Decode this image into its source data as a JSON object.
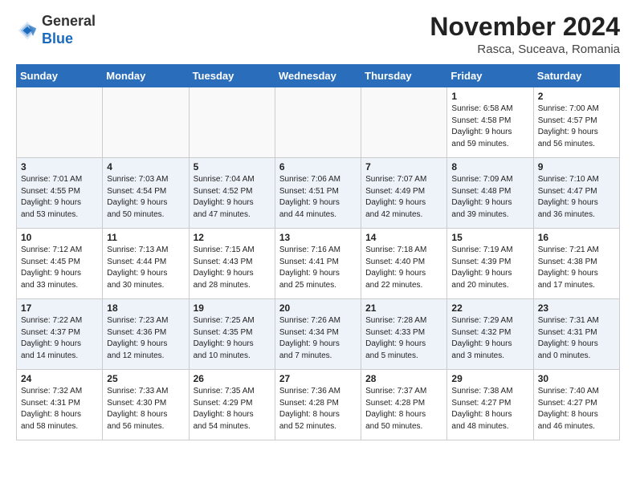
{
  "header": {
    "logo_line1": "General",
    "logo_line2": "Blue",
    "month_title": "November 2024",
    "location": "Rasca, Suceava, Romania"
  },
  "weekdays": [
    "Sunday",
    "Monday",
    "Tuesday",
    "Wednesday",
    "Thursday",
    "Friday",
    "Saturday"
  ],
  "weeks": [
    [
      {
        "day": "",
        "info": ""
      },
      {
        "day": "",
        "info": ""
      },
      {
        "day": "",
        "info": ""
      },
      {
        "day": "",
        "info": ""
      },
      {
        "day": "",
        "info": ""
      },
      {
        "day": "1",
        "info": "Sunrise: 6:58 AM\nSunset: 4:58 PM\nDaylight: 9 hours\nand 59 minutes."
      },
      {
        "day": "2",
        "info": "Sunrise: 7:00 AM\nSunset: 4:57 PM\nDaylight: 9 hours\nand 56 minutes."
      }
    ],
    [
      {
        "day": "3",
        "info": "Sunrise: 7:01 AM\nSunset: 4:55 PM\nDaylight: 9 hours\nand 53 minutes."
      },
      {
        "day": "4",
        "info": "Sunrise: 7:03 AM\nSunset: 4:54 PM\nDaylight: 9 hours\nand 50 minutes."
      },
      {
        "day": "5",
        "info": "Sunrise: 7:04 AM\nSunset: 4:52 PM\nDaylight: 9 hours\nand 47 minutes."
      },
      {
        "day": "6",
        "info": "Sunrise: 7:06 AM\nSunset: 4:51 PM\nDaylight: 9 hours\nand 44 minutes."
      },
      {
        "day": "7",
        "info": "Sunrise: 7:07 AM\nSunset: 4:49 PM\nDaylight: 9 hours\nand 42 minutes."
      },
      {
        "day": "8",
        "info": "Sunrise: 7:09 AM\nSunset: 4:48 PM\nDaylight: 9 hours\nand 39 minutes."
      },
      {
        "day": "9",
        "info": "Sunrise: 7:10 AM\nSunset: 4:47 PM\nDaylight: 9 hours\nand 36 minutes."
      }
    ],
    [
      {
        "day": "10",
        "info": "Sunrise: 7:12 AM\nSunset: 4:45 PM\nDaylight: 9 hours\nand 33 minutes."
      },
      {
        "day": "11",
        "info": "Sunrise: 7:13 AM\nSunset: 4:44 PM\nDaylight: 9 hours\nand 30 minutes."
      },
      {
        "day": "12",
        "info": "Sunrise: 7:15 AM\nSunset: 4:43 PM\nDaylight: 9 hours\nand 28 minutes."
      },
      {
        "day": "13",
        "info": "Sunrise: 7:16 AM\nSunset: 4:41 PM\nDaylight: 9 hours\nand 25 minutes."
      },
      {
        "day": "14",
        "info": "Sunrise: 7:18 AM\nSunset: 4:40 PM\nDaylight: 9 hours\nand 22 minutes."
      },
      {
        "day": "15",
        "info": "Sunrise: 7:19 AM\nSunset: 4:39 PM\nDaylight: 9 hours\nand 20 minutes."
      },
      {
        "day": "16",
        "info": "Sunrise: 7:21 AM\nSunset: 4:38 PM\nDaylight: 9 hours\nand 17 minutes."
      }
    ],
    [
      {
        "day": "17",
        "info": "Sunrise: 7:22 AM\nSunset: 4:37 PM\nDaylight: 9 hours\nand 14 minutes."
      },
      {
        "day": "18",
        "info": "Sunrise: 7:23 AM\nSunset: 4:36 PM\nDaylight: 9 hours\nand 12 minutes."
      },
      {
        "day": "19",
        "info": "Sunrise: 7:25 AM\nSunset: 4:35 PM\nDaylight: 9 hours\nand 10 minutes."
      },
      {
        "day": "20",
        "info": "Sunrise: 7:26 AM\nSunset: 4:34 PM\nDaylight: 9 hours\nand 7 minutes."
      },
      {
        "day": "21",
        "info": "Sunrise: 7:28 AM\nSunset: 4:33 PM\nDaylight: 9 hours\nand 5 minutes."
      },
      {
        "day": "22",
        "info": "Sunrise: 7:29 AM\nSunset: 4:32 PM\nDaylight: 9 hours\nand 3 minutes."
      },
      {
        "day": "23",
        "info": "Sunrise: 7:31 AM\nSunset: 4:31 PM\nDaylight: 9 hours\nand 0 minutes."
      }
    ],
    [
      {
        "day": "24",
        "info": "Sunrise: 7:32 AM\nSunset: 4:31 PM\nDaylight: 8 hours\nand 58 minutes."
      },
      {
        "day": "25",
        "info": "Sunrise: 7:33 AM\nSunset: 4:30 PM\nDaylight: 8 hours\nand 56 minutes."
      },
      {
        "day": "26",
        "info": "Sunrise: 7:35 AM\nSunset: 4:29 PM\nDaylight: 8 hours\nand 54 minutes."
      },
      {
        "day": "27",
        "info": "Sunrise: 7:36 AM\nSunset: 4:28 PM\nDaylight: 8 hours\nand 52 minutes."
      },
      {
        "day": "28",
        "info": "Sunrise: 7:37 AM\nSunset: 4:28 PM\nDaylight: 8 hours\nand 50 minutes."
      },
      {
        "day": "29",
        "info": "Sunrise: 7:38 AM\nSunset: 4:27 PM\nDaylight: 8 hours\nand 48 minutes."
      },
      {
        "day": "30",
        "info": "Sunrise: 7:40 AM\nSunset: 4:27 PM\nDaylight: 8 hours\nand 46 minutes."
      }
    ]
  ]
}
